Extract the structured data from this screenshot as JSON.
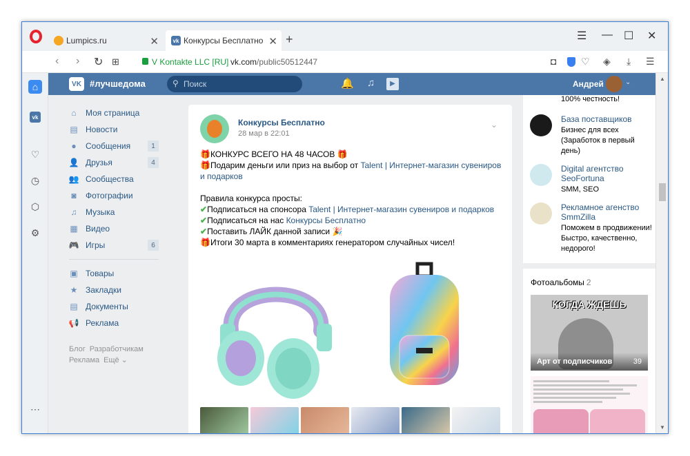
{
  "browser": {
    "tabs": [
      {
        "title": "Lumpics.ru",
        "active": false
      },
      {
        "title": "Конкурсы Бесплатно",
        "active": true
      }
    ],
    "new_tab": "+",
    "site_identity": "V Kontakte LLC [RU]",
    "url_host": "vk.com",
    "url_path": "/public50512447"
  },
  "vk_header": {
    "logo": "VK",
    "title": "#лучшедома",
    "search_placeholder": "Поиск",
    "user_name": "Андрей"
  },
  "menu": {
    "items": [
      {
        "label": "Моя страница",
        "icon": "home-icon",
        "badge": ""
      },
      {
        "label": "Новости",
        "icon": "news-icon",
        "badge": ""
      },
      {
        "label": "Сообщения",
        "icon": "messages-icon",
        "badge": "1"
      },
      {
        "label": "Друзья",
        "icon": "friends-icon",
        "badge": "4"
      },
      {
        "label": "Сообщества",
        "icon": "communities-icon",
        "badge": ""
      },
      {
        "label": "Фотографии",
        "icon": "photos-icon",
        "badge": ""
      },
      {
        "label": "Музыка",
        "icon": "music-icon",
        "badge": ""
      },
      {
        "label": "Видео",
        "icon": "video-icon",
        "badge": ""
      },
      {
        "label": "Игры",
        "icon": "games-icon",
        "badge": "6"
      }
    ],
    "items2": [
      {
        "label": "Товары",
        "icon": "goods-icon"
      },
      {
        "label": "Закладки",
        "icon": "bookmarks-icon"
      },
      {
        "label": "Документы",
        "icon": "documents-icon"
      },
      {
        "label": "Реклама",
        "icon": "ads-icon"
      }
    ],
    "footer": [
      "Блог",
      "Разработчикам",
      "Реклама",
      "Ещё ⌄"
    ]
  },
  "post": {
    "author": "Конкурсы Бесплатно",
    "date": "28 мар в 22:01",
    "line1": "КОНКУРС ВСЕГО НА 48 ЧАСОВ",
    "line2_pre": "Подарим деньги или приз на выбор от ",
    "line2_link": "Talent | Интернет-магазин сувениров и подарков",
    "rules_title": "Правила конкурса просты:",
    "rule1_pre": "Подписаться на спонсора ",
    "rule1_link": "Talent | Интернет-магазин сувениров и подарков",
    "rule2_pre": "Подписаться на нас ",
    "rule2_link": "Конкурсы Бесплатно",
    "rule3": "Поставить ЛАЙК данной записи",
    "rule4": "Итоги 30 марта в комментариях генератором случайных чисел!"
  },
  "right": {
    "top_fragment": "100% честность!",
    "communities": [
      {
        "name": "База поставщиков",
        "desc": "Бизнес для всех (Заработок в первый день)",
        "color": "#1a1a1a"
      },
      {
        "name": "Digital агентство SeoFortuna",
        "desc": "SMM, SEO",
        "color": "#cfe9ee"
      },
      {
        "name": "Рекламное агенство SmmZilla",
        "desc": "Поможем в продвижении! Быстро, качественно, недорого!",
        "color": "#e9e2c9"
      }
    ],
    "albums_title": "Фотоальбомы",
    "albums_count": "2",
    "album1_caption": "КОГДА ЖДЕШЬ",
    "album1_name": "Арт от подписчиков",
    "album1_count": "39"
  },
  "colors": {
    "vk_blue": "#4a76a8",
    "link": "#2a5885",
    "page_bg": "#edeef0",
    "opera_red": "#e4232c"
  }
}
